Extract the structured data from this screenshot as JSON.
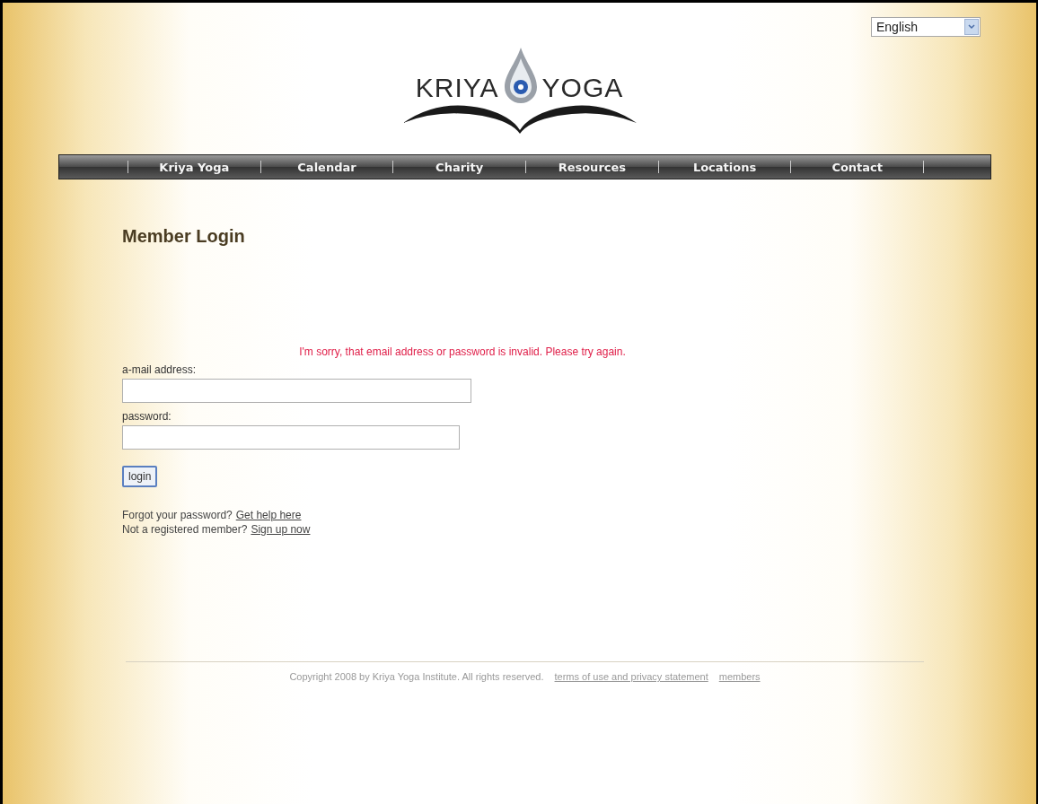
{
  "language_select": {
    "value": "English"
  },
  "logo": {
    "left": "KRIYA",
    "right": "YOGA"
  },
  "nav": [
    {
      "label": "Kriya Yoga"
    },
    {
      "label": "Calendar"
    },
    {
      "label": "Charity"
    },
    {
      "label": "Resources"
    },
    {
      "label": "Locations"
    },
    {
      "label": "Contact"
    }
  ],
  "page_title": "Member Login",
  "error_message": "I'm sorry, that email address or password is invalid. Please try again.",
  "form": {
    "email_label": "a-mail address:",
    "password_label": "password:",
    "login_button": "login"
  },
  "help_lines": [
    {
      "text": "Forgot your password?",
      "link": "Get help here"
    },
    {
      "text": "Not a registered member?",
      "link": "Sign up now"
    }
  ],
  "footer": {
    "copyright": "Copyright 2008 by Kriya Yoga Institute. All rights reserved.",
    "links": [
      "terms of use and privacy statement",
      "members"
    ]
  }
}
